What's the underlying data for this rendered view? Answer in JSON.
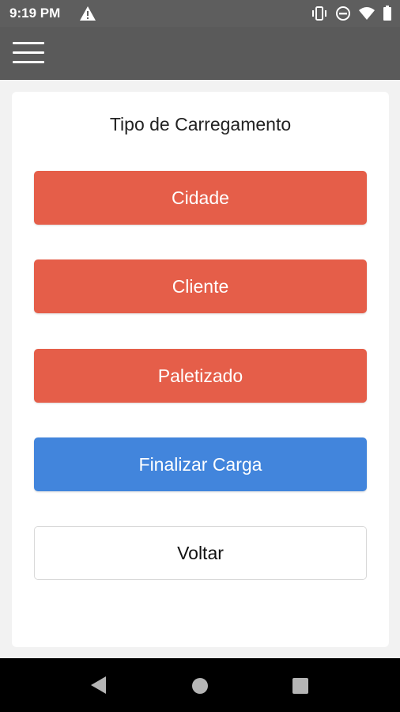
{
  "status_bar": {
    "time": "9:19 PM",
    "icons": [
      "warning-icon",
      "vibrate-icon",
      "do-not-disturb-icon",
      "wifi-icon",
      "battery-icon"
    ]
  },
  "app_bar": {
    "menu_icon": "hamburger-menu-icon"
  },
  "card": {
    "title": "Tipo de Carregamento",
    "buttons": {
      "cidade": "Cidade",
      "cliente": "Cliente",
      "paletizado": "Paletizado",
      "finalizar": "Finalizar Carga",
      "voltar": "Voltar"
    }
  },
  "colors": {
    "status_bar": "#5e5e5e",
    "app_bar": "#5a5a5a",
    "red_button": "#e55e49",
    "blue_button": "#4285dc",
    "background": "#f2f2f2"
  },
  "nav_bar": {
    "icons": [
      "back-icon",
      "home-icon",
      "recents-icon"
    ]
  }
}
